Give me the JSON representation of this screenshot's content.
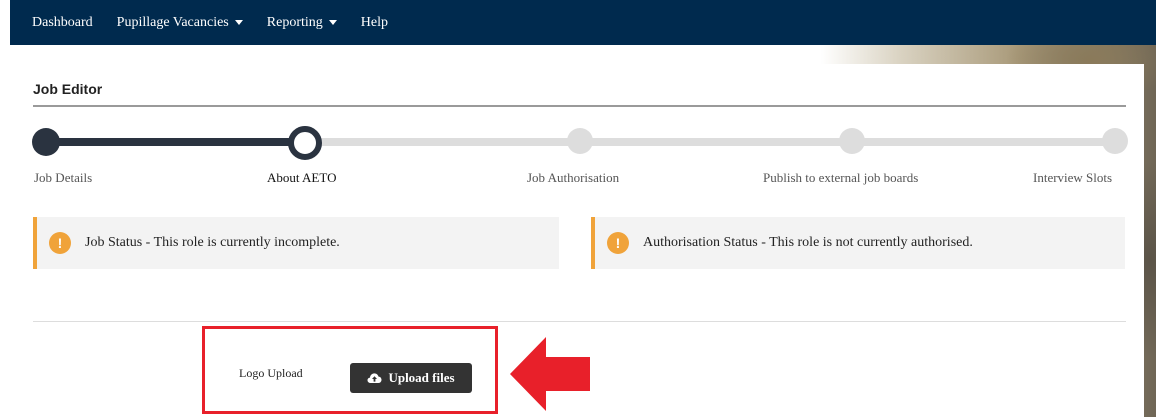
{
  "nav": {
    "items": [
      {
        "label": "Dashboard",
        "has_menu": false
      },
      {
        "label": "Pupillage Vacancies",
        "has_menu": true
      },
      {
        "label": "Reporting",
        "has_menu": true
      },
      {
        "label": "Help",
        "has_menu": false
      }
    ]
  },
  "panel": {
    "title": "Job Editor"
  },
  "stepper": {
    "steps": [
      {
        "label": "Job Details",
        "state": "done"
      },
      {
        "label": "About AETO",
        "state": "current"
      },
      {
        "label": "Job Authorisation",
        "state": "todo"
      },
      {
        "label": "Publish to external job boards",
        "state": "todo"
      },
      {
        "label": "Interview Slots",
        "state": "todo"
      }
    ]
  },
  "alerts": {
    "job_status": "Job Status - This role is currently incomplete.",
    "authorisation_status": "Authorisation Status - This role is not currently authorised.",
    "icon": "exclamation-icon",
    "accent_color": "#f0a33a"
  },
  "upload": {
    "label": "Logo Upload",
    "button_label": "Upload files",
    "icon": "cloud-upload-icon"
  },
  "colors": {
    "navbar": "#002a4e",
    "step_done": "#2a3340",
    "step_todo": "#dddddd",
    "annotation": "#e8202a"
  }
}
